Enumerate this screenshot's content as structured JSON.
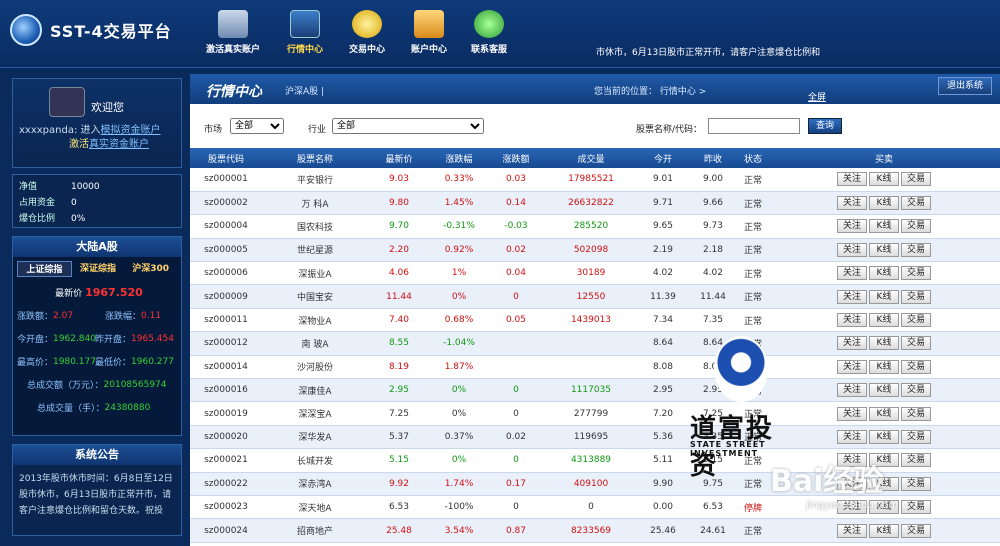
{
  "app": {
    "title": "SST-4交易平台"
  },
  "nav": [
    {
      "label": "激活真实账户"
    },
    {
      "label": "行情中心"
    },
    {
      "label": "交易中心"
    },
    {
      "label": "账户中心"
    },
    {
      "label": "联系客服"
    }
  ],
  "top_notice": "市休市，6月13日股市正常开市，请客户注意爆仓比例和",
  "welcome": {
    "title": "欢迎您",
    "user": "xxxxpanda",
    "enter_text": "进入",
    "sim_link": "模拟资金账户",
    "activate_text": "激活",
    "real_link": "真实资金账户"
  },
  "account": {
    "rows": [
      {
        "k": "净值",
        "v": "10000"
      },
      {
        "k": "占用资金",
        "v": "0"
      },
      {
        "k": "爆仓比例",
        "v": "0%"
      }
    ]
  },
  "market": {
    "title": "大陆A股",
    "tabs": [
      "上证综指",
      "深证综指",
      "沪深300"
    ],
    "latest_label": "最新价",
    "latest": "1967.520",
    "chg_label": "涨跌额：",
    "chg": "2.07",
    "pct_label": "涨跌幅：",
    "pct": "0.11",
    "open_label": "今开盘：",
    "open": "1962.840",
    "prev_label": "昨开盘：",
    "prev": "1965.454",
    "high_label": "最高价：",
    "high": "1980.177",
    "low_label": "最低价：",
    "low": "1960.277",
    "amt_label": "总成交额（万元）：",
    "amt": "20108565974",
    "vol_label": "总成交量（手）：",
    "vol": "24380880"
  },
  "notice": {
    "title": "系统公告",
    "text": "2013年股市休市时间：6月8日至12日股市休市，6月13日股市正常开市，请客户注意爆仓比例和留仓天数。祝投"
  },
  "main": {
    "title": "行情中心",
    "sub": "沪深A股 |",
    "pos": "您当前的位置： 行情中心 >",
    "full": "全屏",
    "logout": "退出系统"
  },
  "filter": {
    "market_label": "市场",
    "market_value": "全部",
    "industry_label": "行业",
    "industry_value": "全部",
    "code_label": "股票名称/代码：",
    "search": "查询"
  },
  "table": {
    "headers": [
      "股票代码",
      "股票名称",
      "最新价",
      "涨跌幅",
      "涨跌额",
      "成交量",
      "今开",
      "昨收",
      "状态",
      "买卖"
    ],
    "buttons": [
      "关注",
      "K线",
      "交易"
    ],
    "rows": [
      [
        "sz000001",
        "平安银行",
        "9.03",
        "0.33%",
        "0.03",
        "17985521",
        "9.01",
        "9.00",
        "正常",
        "up"
      ],
      [
        "sz000002",
        "万 科A",
        "9.80",
        "1.45%",
        "0.14",
        "26632822",
        "9.71",
        "9.66",
        "正常",
        "up"
      ],
      [
        "sz000004",
        "国农科技",
        "9.70",
        "-0.31%",
        "-0.03",
        "285520",
        "9.65",
        "9.73",
        "正常",
        "dn"
      ],
      [
        "sz000005",
        "世纪星源",
        "2.20",
        "0.92%",
        "0.02",
        "502098",
        "2.19",
        "2.18",
        "正常",
        "up"
      ],
      [
        "sz000006",
        "深振业A",
        "4.06",
        "1%",
        "0.04",
        "30189",
        "4.02",
        "4.02",
        "正常",
        "up"
      ],
      [
        "sz000009",
        "中国宝安",
        "11.44",
        "0%",
        "0",
        "12550",
        "11.39",
        "11.44",
        "正常",
        "up"
      ],
      [
        "sz000011",
        "深物业A",
        "7.40",
        "0.68%",
        "0.05",
        "1439013",
        "7.34",
        "7.35",
        "正常",
        "up"
      ],
      [
        "sz000012",
        "南 玻A",
        "8.55",
        "-1.04%",
        "",
        "",
        "8.64",
        "8.64",
        "正常",
        "dn"
      ],
      [
        "sz000014",
        "沙河股份",
        "8.19",
        "1.87%",
        "",
        "",
        "8.08",
        "8.04",
        "正常",
        "up"
      ],
      [
        "sz000016",
        "深康佳A",
        "2.95",
        "0%",
        "0",
        "1117035",
        "2.95",
        "2.95",
        "正常",
        "dn"
      ],
      [
        "sz000019",
        "深深宝A",
        "7.25",
        "0%",
        "0",
        "277799",
        "7.20",
        "7.25",
        "正常",
        "eq"
      ],
      [
        "sz000020",
        "深华发A",
        "5.37",
        "0.37%",
        "0.02",
        "119695",
        "5.36",
        "5.35",
        "正常",
        "eq"
      ],
      [
        "sz000021",
        "长城开发",
        "5.15",
        "0%",
        "0",
        "4313889",
        "5.11",
        "5.15",
        "正常",
        "dn"
      ],
      [
        "sz000022",
        "深赤湾A",
        "9.92",
        "1.74%",
        "0.17",
        "409100",
        "9.90",
        "9.75",
        "正常",
        "up"
      ],
      [
        "sz000023",
        "深天地A",
        "6.53",
        "-100%",
        "0",
        "0",
        "0.00",
        "6.53",
        "停牌",
        "eq"
      ],
      [
        "sz000024",
        "招商地产",
        "25.48",
        "3.54%",
        "0.87",
        "8233569",
        "25.46",
        "24.61",
        "正常",
        "up"
      ]
    ]
  },
  "watermark": {
    "brand": "道富投资",
    "sub": "STATE STREET INVESTMENT"
  },
  "baidu": {
    "logo": "Bai经验",
    "url": "jingyan.baidu.com"
  }
}
